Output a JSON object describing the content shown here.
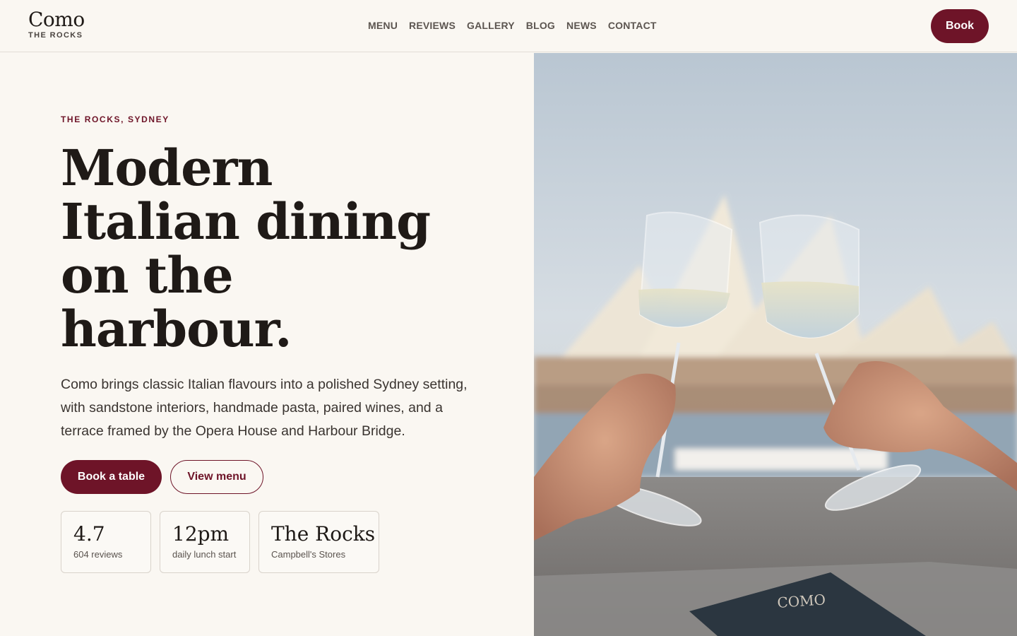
{
  "header": {
    "logo_main": "Como",
    "logo_sub": "THE ROCKS",
    "nav": [
      "MENU",
      "REVIEWS",
      "GALLERY",
      "BLOG",
      "NEWS",
      "CONTACT"
    ],
    "book_label": "Book"
  },
  "hero": {
    "eyebrow": "THE ROCKS, SYDNEY",
    "headline_lines": [
      "Modern",
      "Italian dining",
      "on the",
      "harbour."
    ],
    "lead": "Como brings classic Italian flavours into a polished Sydney setting, with sandstone interiors, handmade pasta, paired wines, and a terrace framed by the Opera House and Harbour Bridge.",
    "cta_primary": "Book a table",
    "cta_secondary": "View menu",
    "stats": [
      {
        "value": "4.7",
        "label": "604 reviews"
      },
      {
        "value": "12pm",
        "label": "daily lunch start"
      },
      {
        "value": "The Rocks",
        "label": "Campbell's Stores"
      }
    ],
    "image_alt_text": "COMO"
  },
  "colors": {
    "accent": "#6e1428",
    "background": "#faf7f2",
    "text": "#1f1a17"
  }
}
